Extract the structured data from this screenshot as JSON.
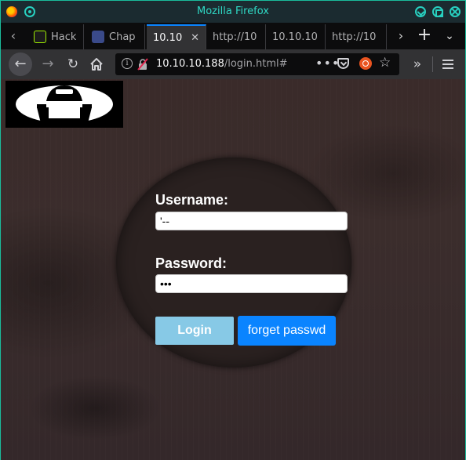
{
  "window": {
    "title": "Mozilla Firefox"
  },
  "tabs": [
    {
      "label": "Hack",
      "icon": "hackthebox-icon"
    },
    {
      "label": "Chap",
      "icon": "chap-icon"
    },
    {
      "label": "10.10",
      "active": true
    },
    {
      "label": "http://10"
    },
    {
      "label": "10.10.10"
    },
    {
      "label": "http://10"
    }
  ],
  "urlbar": {
    "host": "10.10.10.188",
    "path": "/login.html#",
    "overflow_label": "•••"
  },
  "page": {
    "username_label": "Username:",
    "username_value": "'--",
    "password_label": "Password:",
    "password_value": "•••",
    "login_label": "Login",
    "forget_label": "forget passwd"
  },
  "colors": {
    "accent": "#1abc9c",
    "login_button": "#87c9e6",
    "forget_button": "#0a84ff",
    "page_background": "#3a2b2a"
  }
}
